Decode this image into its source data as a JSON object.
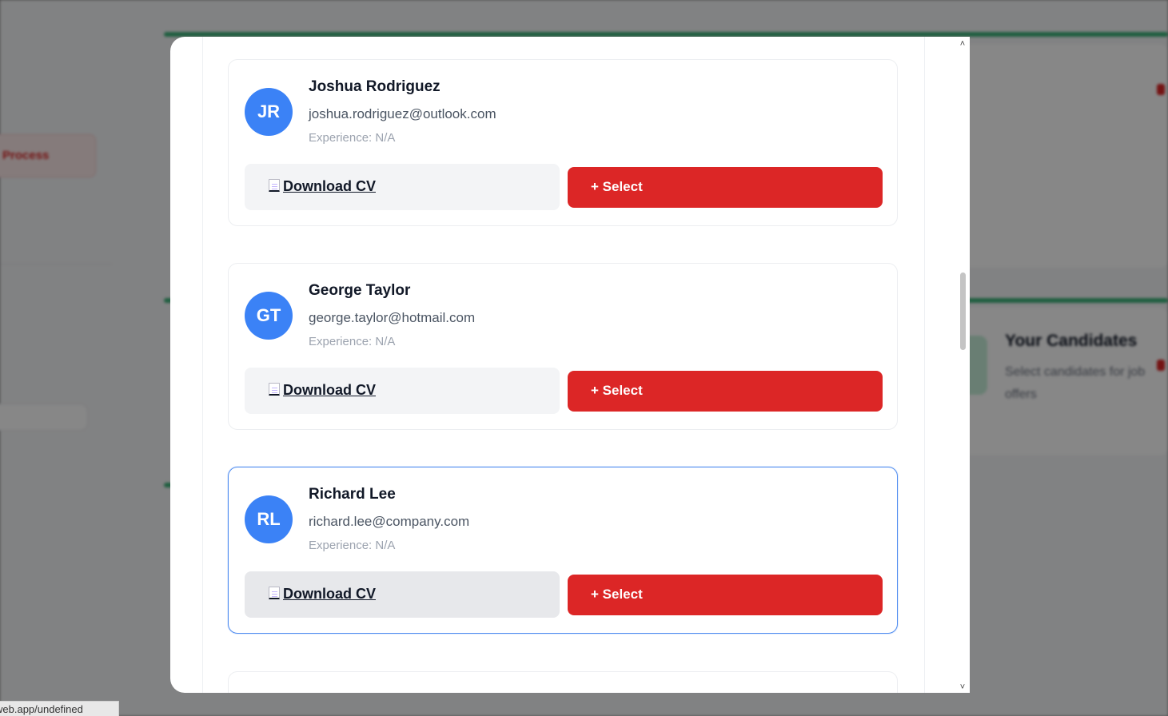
{
  "background": {
    "process_button_label": "Process",
    "candidates_title": "Your Candidates",
    "candidates_subtitle": "Select candidates for job offers"
  },
  "status_bar": {
    "url": "web.app/undefined"
  },
  "candidates": [
    {
      "initials": "JR",
      "name": "Joshua Rodriguez",
      "email": "joshua.rodriguez@outlook.com",
      "experience": "Experience: N/A",
      "download_label": "Download CV",
      "select_label": "+ Select"
    },
    {
      "initials": "GT",
      "name": "George Taylor",
      "email": "george.taylor@hotmail.com",
      "experience": "Experience: N/A",
      "download_label": "Download CV",
      "select_label": "+ Select"
    },
    {
      "initials": "RL",
      "name": "Richard Lee",
      "email": "richard.lee@company.com",
      "experience": "Experience: N/A",
      "download_label": "Download CV",
      "select_label": "+ Select"
    }
  ],
  "icons": {
    "document": "document-icon",
    "scroll_up": "chevron-up-icon",
    "scroll_down": "chevron-down-icon"
  },
  "colors": {
    "avatar": "#3b82f6",
    "select_button": "#dc2626",
    "selected_border": "#4f8cf0",
    "accent_green": "#3db37a"
  }
}
